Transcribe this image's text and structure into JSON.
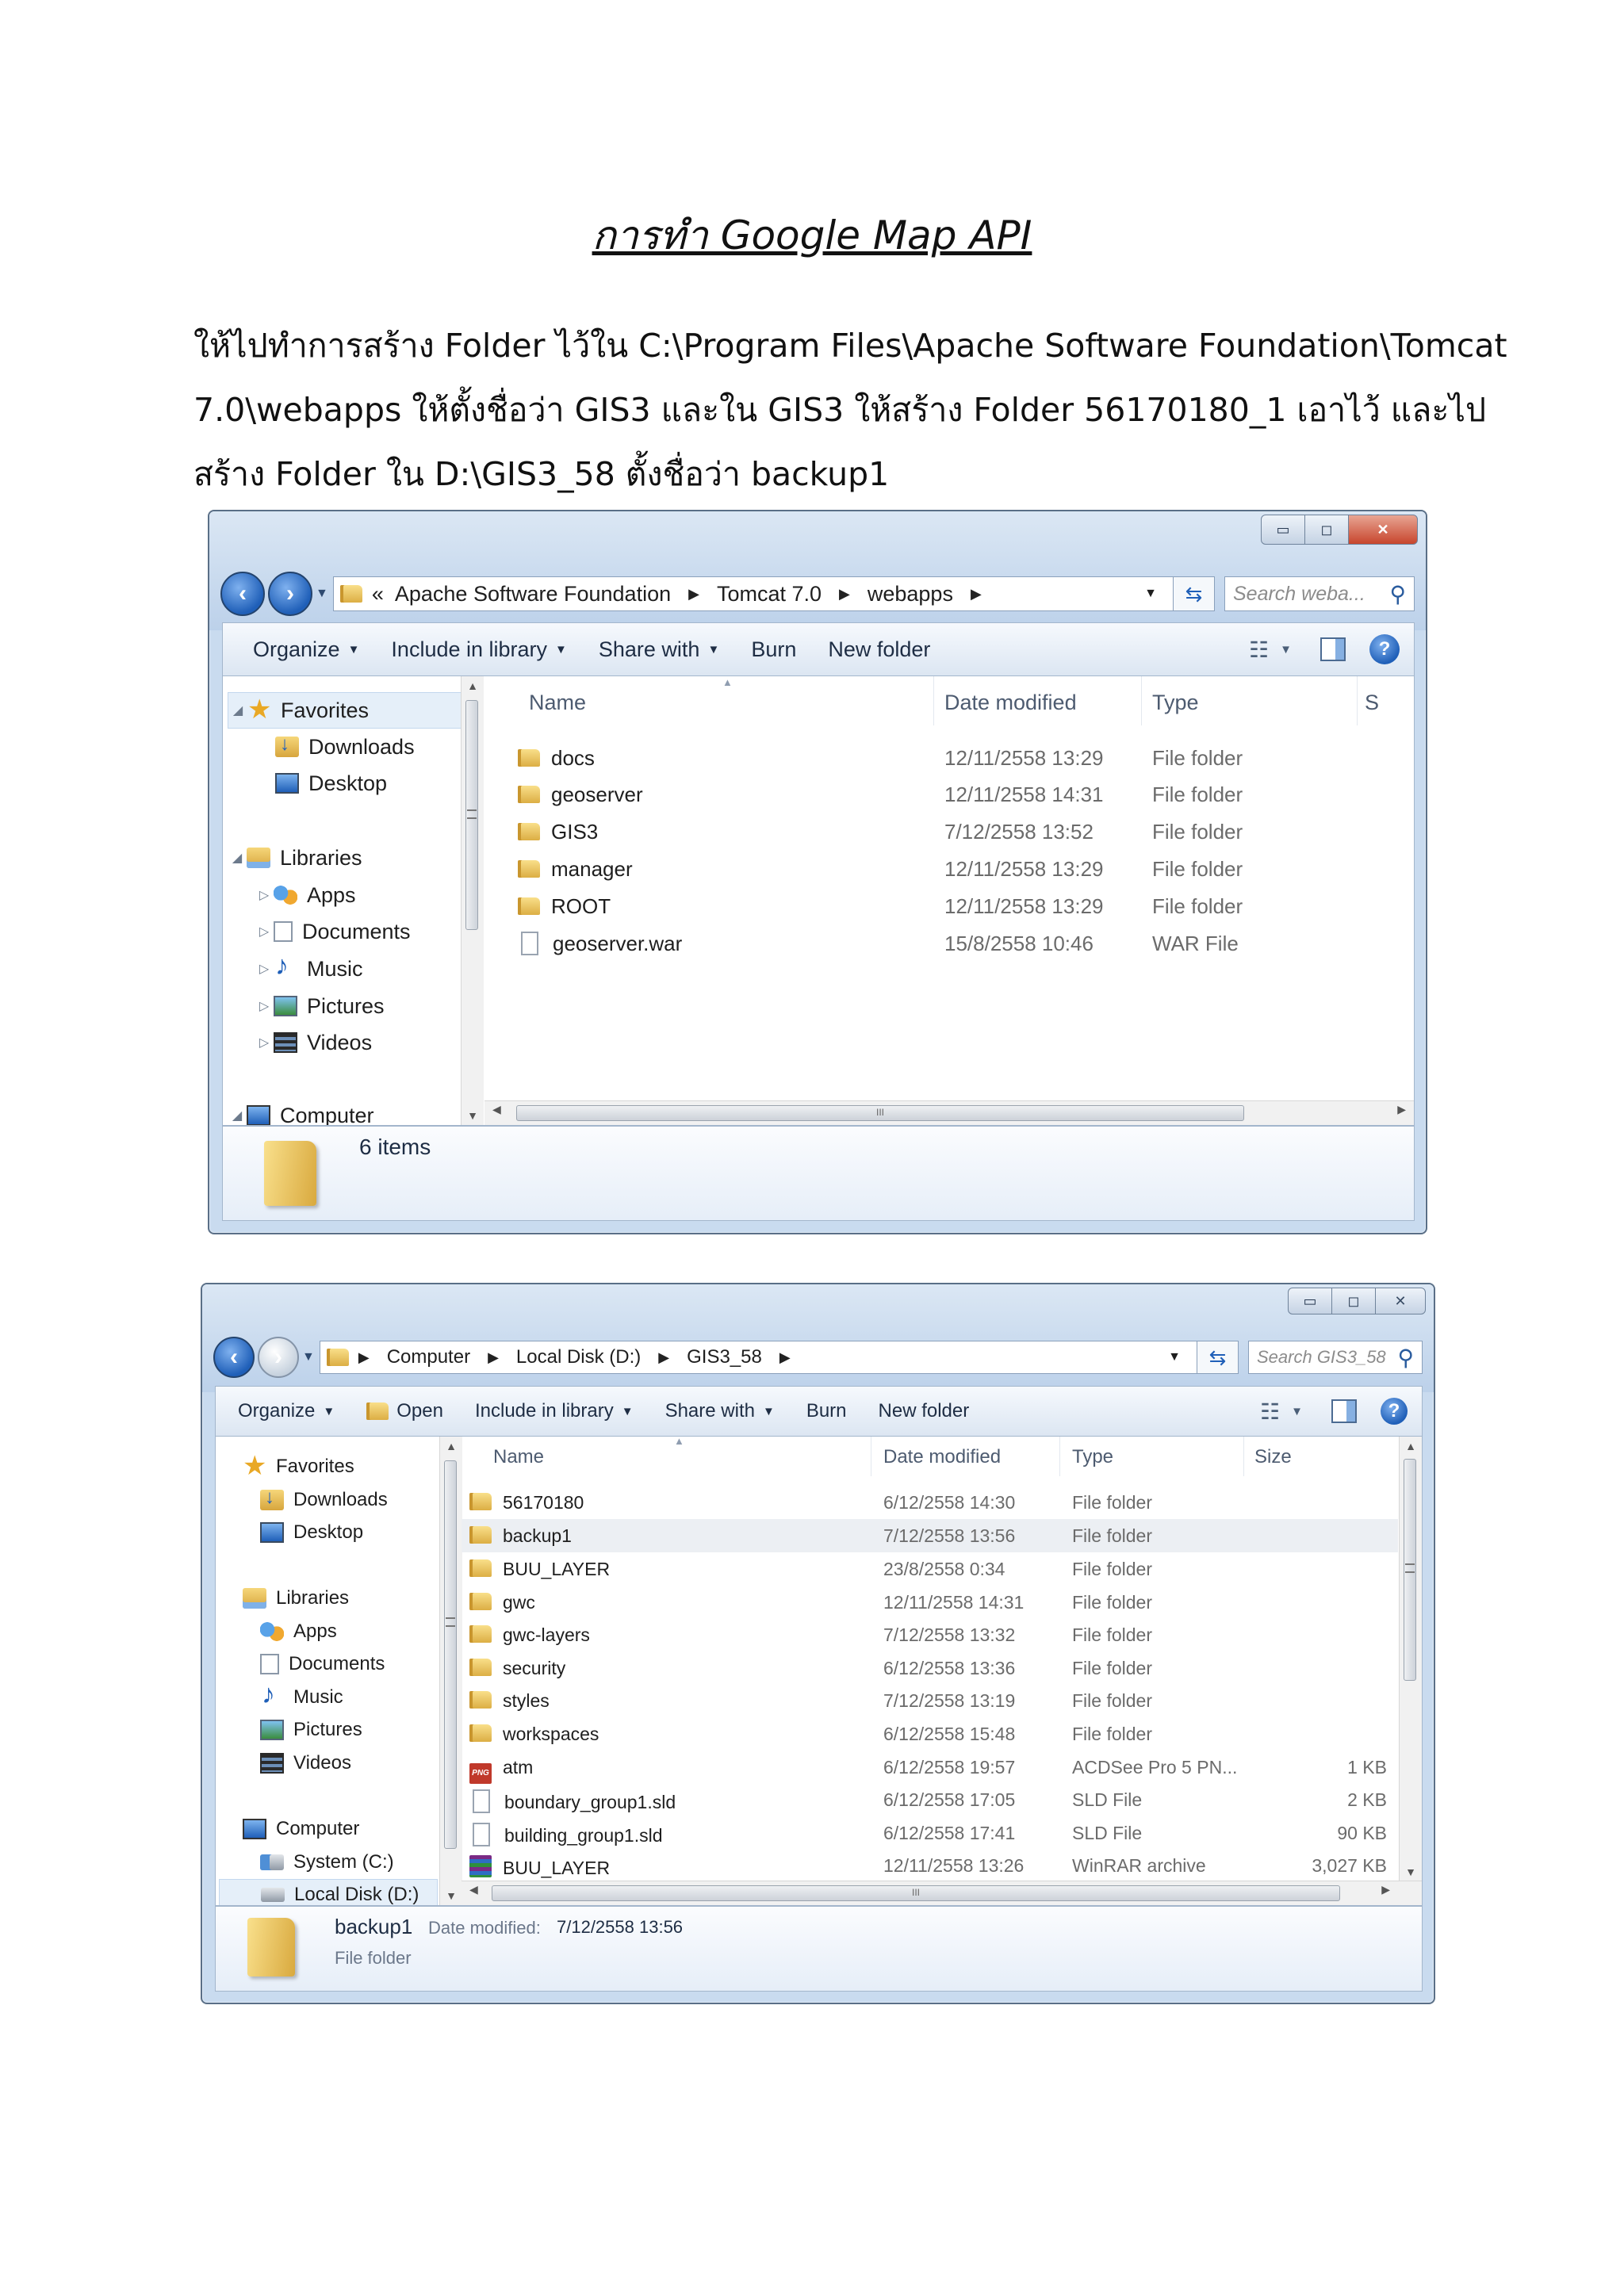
{
  "document": {
    "title": "การทำ Google Map API",
    "paragraph_lines": [
      "ให้ไปทำการสร้าง Folder ไว้ใน  C:\\Program Files\\Apache Software Foundation\\Tomcat",
      "7.0\\webapps ให้ตั้งชื่อว่า GIS3 และใน GIS3 ให้สร้าง Folder 56170180_1 เอาไว้  และไป",
      "สร้าง Folder ใน D:\\GIS3_58 ตั้งชื่อว่า backup1"
    ]
  },
  "window_controls": {
    "minimize": "▭",
    "maximize": "◻",
    "close": "✕"
  },
  "window1": {
    "breadcrumb": {
      "overflow": "«",
      "items": [
        "Apache Software Foundation",
        "Tomcat 7.0",
        "webapps"
      ]
    },
    "search_placeholder": "Search weba...",
    "toolbar": [
      "Organize",
      "Include in library",
      "Share with",
      "Burn",
      "New folder"
    ],
    "nav": {
      "favorites": "Favorites",
      "downloads": "Downloads",
      "desktop": "Desktop",
      "libraries": "Libraries",
      "apps": "Apps",
      "documents": "Documents",
      "music": "Music",
      "pictures": "Pictures",
      "videos": "Videos",
      "computer": "Computer"
    },
    "columns": {
      "name": "Name",
      "date": "Date modified",
      "type": "Type",
      "size": "S"
    },
    "files": [
      {
        "name": "docs",
        "date": "12/11/2558 13:29",
        "type": "File folder",
        "icon": "folder-icon"
      },
      {
        "name": "geoserver",
        "date": "12/11/2558 14:31",
        "type": "File folder",
        "icon": "folder-icon"
      },
      {
        "name": "GIS3",
        "date": "7/12/2558 13:52",
        "type": "File folder",
        "icon": "folder-icon"
      },
      {
        "name": "manager",
        "date": "12/11/2558 13:29",
        "type": "File folder",
        "icon": "folder-icon"
      },
      {
        "name": "ROOT",
        "date": "12/11/2558 13:29",
        "type": "File folder",
        "icon": "folder-icon"
      },
      {
        "name": "geoserver.war",
        "date": "15/8/2558 10:46",
        "type": "WAR File",
        "icon": "file-icon"
      }
    ],
    "status": "6 items",
    "hscroll_grip": "III"
  },
  "window2": {
    "breadcrumb": {
      "items": [
        "Computer",
        "Local Disk (D:)",
        "GIS3_58"
      ]
    },
    "search_placeholder": "Search GIS3_58",
    "toolbar": [
      "Organize",
      "Open",
      "Include in library",
      "Share with",
      "Burn",
      "New folder"
    ],
    "nav": {
      "favorites": "Favorites",
      "downloads": "Downloads",
      "desktop": "Desktop",
      "libraries": "Libraries",
      "apps": "Apps",
      "documents": "Documents",
      "music": "Music",
      "pictures": "Pictures",
      "videos": "Videos",
      "computer": "Computer",
      "system": "System  (C:)",
      "localdisk": "Local Disk (D:)"
    },
    "columns": {
      "name": "Name",
      "date": "Date modified",
      "type": "Type",
      "size": "Size"
    },
    "files": [
      {
        "name": "56170180",
        "date": "6/12/2558 14:30",
        "type": "File folder",
        "size": "",
        "icon": "folder-icon"
      },
      {
        "name": "backup1",
        "date": "7/12/2558 13:56",
        "type": "File folder",
        "size": "",
        "icon": "folder-icon"
      },
      {
        "name": "BUU_LAYER",
        "date": "23/8/2558 0:34",
        "type": "File folder",
        "size": "",
        "icon": "folder-icon"
      },
      {
        "name": "gwc",
        "date": "12/11/2558 14:31",
        "type": "File folder",
        "size": "",
        "icon": "folder-icon"
      },
      {
        "name": "gwc-layers",
        "date": "7/12/2558 13:32",
        "type": "File folder",
        "size": "",
        "icon": "folder-icon"
      },
      {
        "name": "security",
        "date": "6/12/2558 13:36",
        "type": "File folder",
        "size": "",
        "icon": "folder-icon"
      },
      {
        "name": "styles",
        "date": "7/12/2558 13:19",
        "type": "File folder",
        "size": "",
        "icon": "folder-icon"
      },
      {
        "name": "workspaces",
        "date": "6/12/2558 15:48",
        "type": "File folder",
        "size": "",
        "icon": "folder-icon"
      },
      {
        "name": "atm",
        "date": "6/12/2558 19:57",
        "type": "ACDSee Pro 5 PN...",
        "size": "1 KB",
        "icon": "png-icon"
      },
      {
        "name": "boundary_group1.sld",
        "date": "6/12/2558 17:05",
        "type": "SLD File",
        "size": "2 KB",
        "icon": "file-icon"
      },
      {
        "name": "building_group1.sld",
        "date": "6/12/2558 17:41",
        "type": "SLD File",
        "size": "90 KB",
        "icon": "file-icon"
      },
      {
        "name": "BUU_LAYER",
        "date": "12/11/2558 13:26",
        "type": "WinRAR archive",
        "size": "3,027 KB",
        "icon": "rar-icon"
      }
    ],
    "selected_index": 1,
    "details": {
      "name": "backup1",
      "date_label": "Date modified:",
      "date": "7/12/2558 13:56",
      "type": "File folder"
    },
    "hscroll_grip": "III"
  }
}
